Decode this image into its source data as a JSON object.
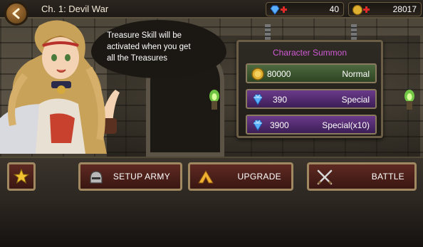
{
  "header": {
    "chapter_title": "Ch. 1: Devil War",
    "gems": "40",
    "gold": "28017"
  },
  "dialog": {
    "text": "Treasure Skill will be activated when you get all the Treasures"
  },
  "summon_panel": {
    "title": "Character Summon",
    "options": [
      {
        "cost": "80000",
        "kind": "Normal",
        "currency_icon": "gold-coin-icon"
      },
      {
        "cost": "390",
        "kind": "Special",
        "currency_icon": "gem-icon"
      },
      {
        "cost": "3900",
        "kind": "Special(x10)",
        "currency_icon": "gem-icon"
      }
    ]
  },
  "actions": {
    "setup_army": "SETUP ARMY",
    "upgrade": "UPGRADE",
    "battle": "BATTLE"
  },
  "colors": {
    "summon_title": "#d15ad6",
    "normal_button": "#3e5a32",
    "special_button": "#54306e",
    "action_button": "#4c2018"
  }
}
